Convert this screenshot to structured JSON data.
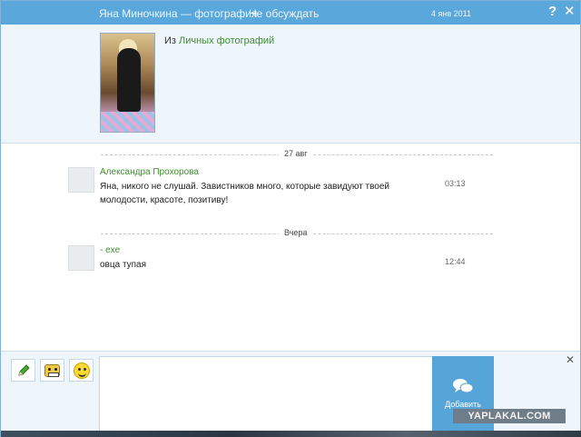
{
  "header": {
    "title": "Яна Миночкина — фотография",
    "no_discuss_link": "Не обсуждать",
    "date": "4 янв 2011",
    "help_label": "?",
    "close_label": "✕"
  },
  "photo": {
    "from_prefix": "Из",
    "album_link": "Личных фотографий"
  },
  "comments": {
    "groups": [
      {
        "date_label": "27 авг",
        "messages": [
          {
            "author": "Александра Прохорова",
            "text": "Яна, никого не слушай. Завистников много, которые завидуют твоей молодости, красоте, позитиву!",
            "time": "03:13"
          }
        ]
      },
      {
        "date_label": "Вчера",
        "messages": [
          {
            "author": "- exe",
            "text": "овца тупая",
            "time": "12:44"
          }
        ]
      }
    ]
  },
  "composer": {
    "value": "",
    "add_button_label": "Добавить",
    "close_label": "✕",
    "tools": [
      "pencil-icon",
      "robot-sticker-icon",
      "smiley-icon"
    ]
  },
  "watermark": "YAPLAKAL.COM",
  "colors": {
    "header_bg": "#5aa7db",
    "link_green": "#3d8f2d",
    "panel_bg": "#eef6fb",
    "button_blue": "#56a5d8"
  }
}
